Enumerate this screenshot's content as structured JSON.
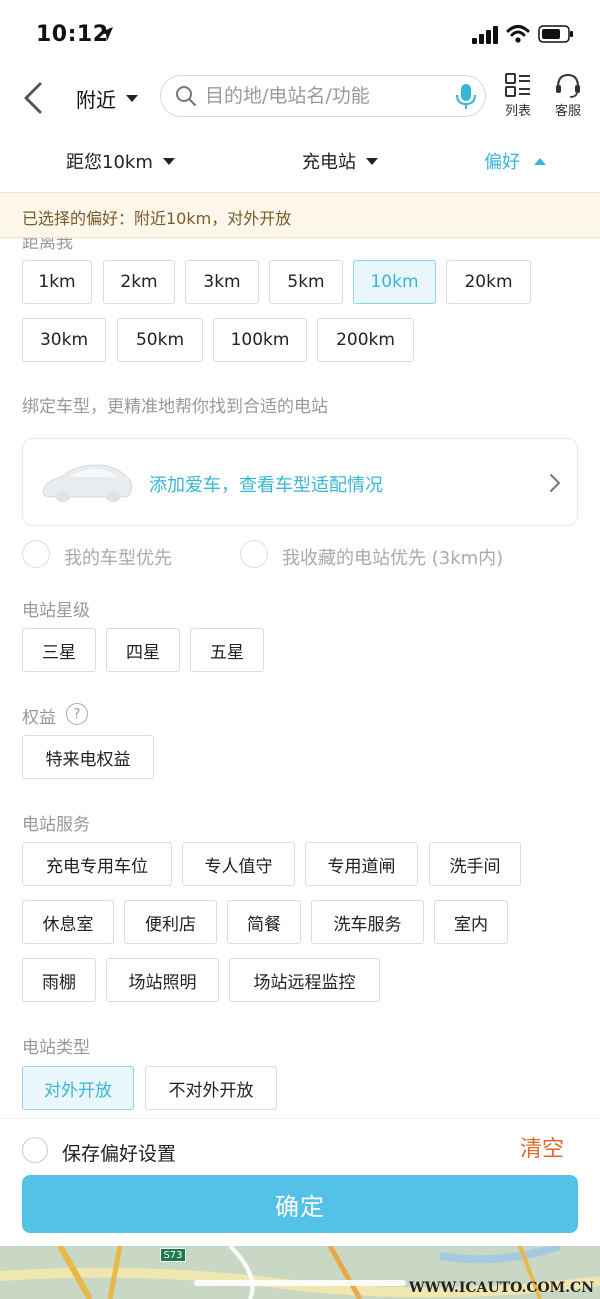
{
  "status_bar": {
    "time": "10:12"
  },
  "nav": {
    "location_label": "附近",
    "search_placeholder": "目的地/电站名/功能",
    "list_label": "列表",
    "service_label": "客服"
  },
  "filter_tabs": [
    {
      "label": "距您10km"
    },
    {
      "label": "充电站"
    },
    {
      "label": "偏好"
    }
  ],
  "banner": {
    "text": "已选择的偏好：附近10km，对外开放"
  },
  "distance": {
    "title": "距离我",
    "options": [
      "1km",
      "2km",
      "3km",
      "5km",
      "10km",
      "20km",
      "30km",
      "50km",
      "100km",
      "200km"
    ],
    "selected": "10km"
  },
  "car_binding": {
    "hint": "绑定车型，更精准地帮你找到合适的电站",
    "card_text": "添加爱车，查看车型适配情况",
    "option_car_first": "我的车型优先",
    "option_fav_first": "我收藏的电站优先 (3km内)"
  },
  "star_level": {
    "title": "电站星级",
    "options": [
      "三星",
      "四星",
      "五星"
    ]
  },
  "benefits": {
    "title": "权益",
    "help": "?",
    "options": [
      "特来电权益"
    ]
  },
  "services": {
    "title": "电站服务",
    "options": [
      "充电专用车位",
      "专人值守",
      "专用道闸",
      "洗手间",
      "休息室",
      "便利店",
      "简餐",
      "洗车服务",
      "室内",
      "雨棚",
      "场站照明",
      "场站远程监控"
    ]
  },
  "station_type": {
    "title": "电站类型",
    "options": [
      "对外开放",
      "不对外开放"
    ],
    "selected": "对外开放"
  },
  "footer": {
    "save_label": "保存偏好设置",
    "clear_label": "清空",
    "confirm_label": "确定"
  },
  "map": {
    "road_sign": "S73"
  },
  "watermark": "WWW.ICAUTO.COM.CN",
  "colors": {
    "accent": "#38b6d8",
    "confirm": "#53c2e6",
    "clear": "#e06a2e",
    "banner_bg": "#fdf6ea"
  }
}
